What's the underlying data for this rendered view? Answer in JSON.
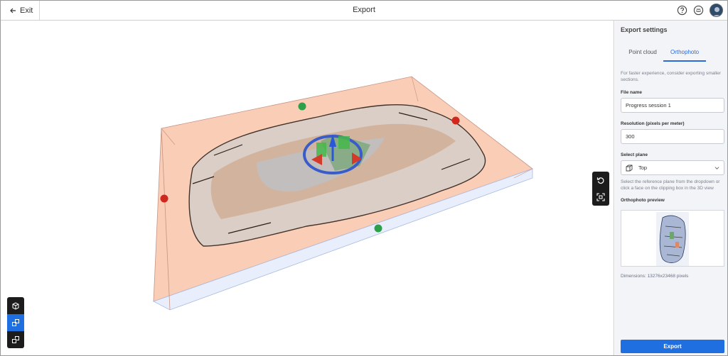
{
  "header": {
    "exit_label": "Exit",
    "title": "Export",
    "help_icon": "help-circle-icon",
    "support_icon": "chat-circle-icon"
  },
  "viewport": {
    "left_tools": [
      "box-icon",
      "transform-icon",
      "layers-icon"
    ],
    "right_tools": [
      "reset-icon",
      "fit-view-icon"
    ],
    "colors": {
      "clip_box": "#f9c9b0",
      "handle_red": "#d0281c",
      "handle_green": "#2ea04a",
      "gizmo_blue": "#3a5cc8"
    }
  },
  "panel": {
    "title": "Export settings",
    "tabs": [
      "Point cloud",
      "Orthophoto"
    ],
    "active_tab": "Orthophoto",
    "hint": "For faster experience, consider exporting smaller sections.",
    "file_name_label": "File name",
    "file_name_value": "Progress session 1",
    "resolution_label": "Resolution (pixels per meter)",
    "resolution_value": "300",
    "plane_label": "Select plane",
    "plane_value": "Top",
    "plane_help": "Select the reference plane from the dropdown or click a face on the clipping box in the 3D view",
    "preview_label": "Orthophoto preview",
    "dimensions": "Dimensions: 13276x23468 pixels",
    "export_button": "Export",
    "accent_color": "#1f6fe0"
  }
}
